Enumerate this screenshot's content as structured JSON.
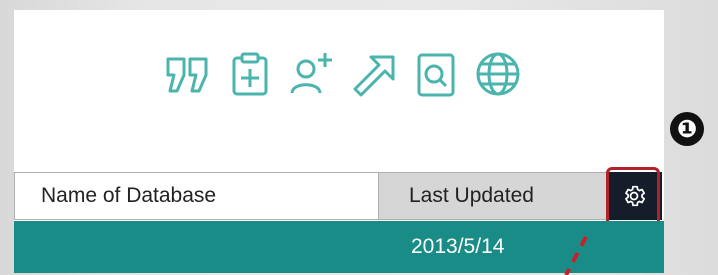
{
  "toolbar": {
    "icons": [
      "quote-icon",
      "clipboard-add-icon",
      "add-user-icon",
      "share-arrow-icon",
      "document-search-icon",
      "globe-icon"
    ]
  },
  "step_badge": "❶",
  "table": {
    "columns": [
      "Name of Database",
      "Last Updated"
    ],
    "rows": [
      {
        "name": "",
        "last_updated": "2013/5/14"
      }
    ]
  },
  "colors": {
    "accent_teal": "#1a8c88",
    "icon_teal": "#4ab4ad",
    "header_dark": "#151d2b",
    "highlight_red": "#b0232a",
    "annotation_red": "#c8202a"
  }
}
